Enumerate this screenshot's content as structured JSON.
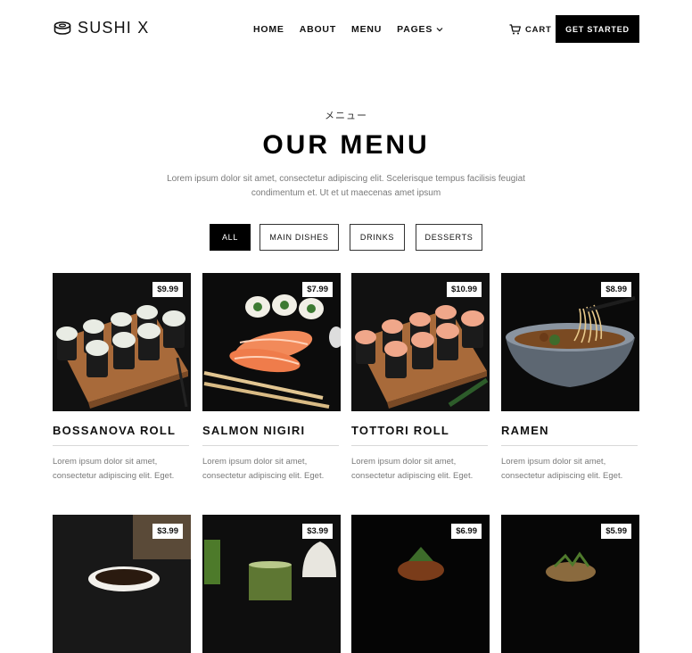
{
  "brand": {
    "name": "SUSHI X",
    "icon": "sushi-roll-icon"
  },
  "nav": {
    "items": [
      {
        "label": "HOME"
      },
      {
        "label": "ABOUT"
      },
      {
        "label": "MENU"
      },
      {
        "label": "PAGES",
        "icon": "chevron-down-icon"
      }
    ],
    "cart_label": "CART",
    "cart_icon": "cart-icon",
    "cta_label": "GET STARTED"
  },
  "intro": {
    "kicker": "メニュー",
    "title": "OUR MENU",
    "description": "Lorem ipsum dolor sit amet, consectetur adipiscing elit. Scelerisque tempus facilisis feugiat condimentum et. Ut et ut maecenas amet ipsum"
  },
  "filters": [
    {
      "label": "ALL",
      "active": true
    },
    {
      "label": "MAIN DISHES",
      "active": false
    },
    {
      "label": "DRINKS",
      "active": false
    },
    {
      "label": "DESSERTS",
      "active": false
    }
  ],
  "menu": [
    {
      "name": "BOSSANOVA ROLL",
      "price": "$9.99",
      "description": "Lorem ipsum dolor sit amet, consectetur adipiscing elit. Eget."
    },
    {
      "name": "SALMON NIGIRI",
      "price": "$7.99",
      "description": "Lorem ipsum dolor sit amet, consectetur adipiscing elit. Eget."
    },
    {
      "name": "TOTTORI ROLL",
      "price": "$10.99",
      "description": "Lorem ipsum dolor sit amet, consectetur adipiscing elit. Eget."
    },
    {
      "name": "RAMEN",
      "price": "$8.99",
      "description": "Lorem ipsum dolor sit amet, consectetur adipiscing elit. Eget."
    },
    {
      "name": "",
      "price": "$3.99",
      "description": ""
    },
    {
      "name": "",
      "price": "$3.99",
      "description": ""
    },
    {
      "name": "",
      "price": "$6.99",
      "description": ""
    },
    {
      "name": "",
      "price": "$5.99",
      "description": ""
    }
  ],
  "colors": {
    "primary": "#000000",
    "text_muted": "#7a7a7a",
    "divider": "#d8d8d8"
  }
}
